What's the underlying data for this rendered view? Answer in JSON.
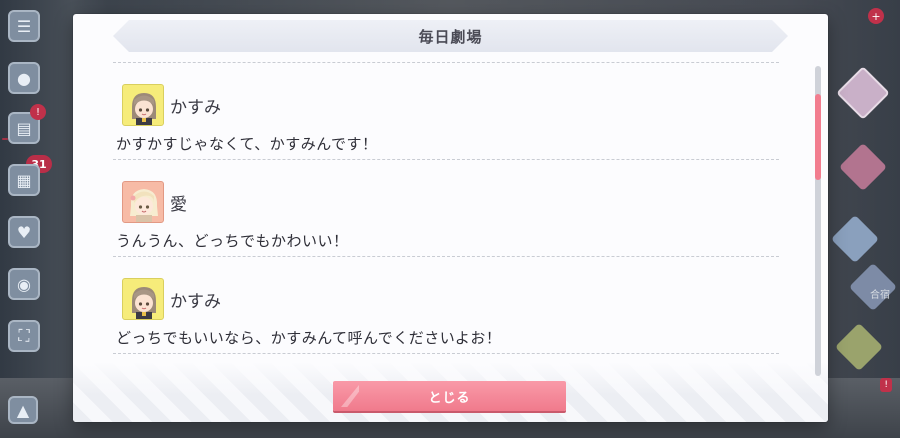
{
  "dialog": {
    "title": "毎日劇場",
    "close_label": "とじる"
  },
  "messages": [
    {
      "speaker": "かすみ",
      "avatar": "kasumi-chibi-portrait",
      "text": "かすかすじゃなくて、かすみんです！"
    },
    {
      "speaker": "愛",
      "avatar": "ai-chibi-portrait",
      "text": "うんうん、どっちでもかわいい！"
    },
    {
      "speaker": "かすみ",
      "avatar": "kasumi-chibi-portrait",
      "text": "どっちでもいいなら、かすみんて呼んでくださいよお！"
    }
  ],
  "background": {
    "badge_count": "31",
    "right_label": "合宿"
  },
  "colors": {
    "accent": "#f07a8c",
    "scroll_thumb": "#f27d8f",
    "avatar_kasumi_bg": "#f6ec7a",
    "avatar_ai_bg": "#f7bba6",
    "notification": "#c0314a"
  },
  "scroll": {
    "position_fraction": 0.1
  }
}
